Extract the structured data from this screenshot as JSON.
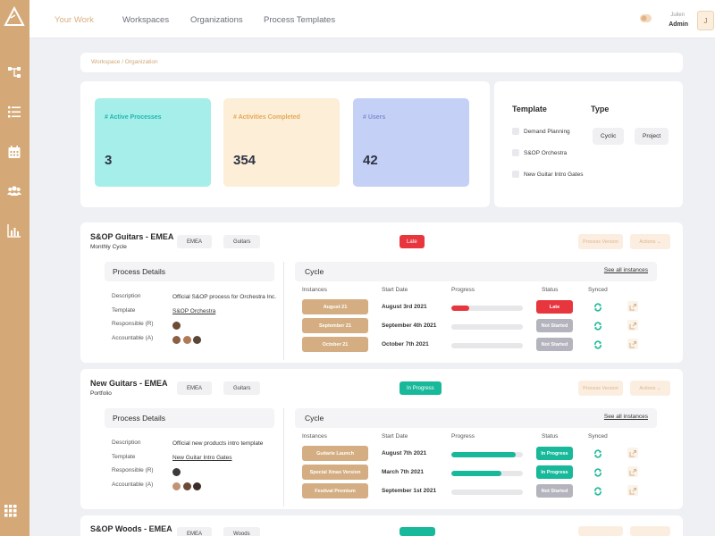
{
  "colors": {
    "accent": "#d5a977",
    "teal": "#18b99a",
    "red": "#e8363f",
    "grey": "#b4b4be"
  },
  "rail": {
    "icons": [
      "logo-triangle-icon",
      "hierarchy-icon",
      "list-icon",
      "calendar-icon",
      "users-icon",
      "bar-chart-icon",
      "apps-grid-icon"
    ]
  },
  "nav": {
    "items": [
      "Your Work",
      "Workspaces",
      "Organizations",
      "Process Templates"
    ],
    "active": "Your Work"
  },
  "user": {
    "name": "Julien",
    "role": "Admin",
    "avatar_initial": "J"
  },
  "breadcrumb": "Workspace / Organization",
  "stats": [
    {
      "label": "# Active Processes",
      "value": "3"
    },
    {
      "label": "# Activities Completed",
      "value": "354"
    },
    {
      "label": "# Users",
      "value": "42"
    }
  ],
  "filters": {
    "template_heading": "Template",
    "templates": [
      "Demand Planning",
      "S&OP Orchestra",
      "New Guitar Intro Gates"
    ],
    "type_heading": "Type",
    "types": [
      "Cyclic",
      "Project"
    ]
  },
  "processes": [
    {
      "title": "S&OP Guitars - EMEA",
      "subtitle": "Monthly Cycle",
      "tags": [
        "EMEA",
        "Guitars"
      ],
      "state": "Late",
      "state_color": "#e8363f",
      "process_version_label": "Process Version",
      "actions_label": "Actions",
      "details_title": "Process Details",
      "details": {
        "description_label": "Description",
        "description": "Official S&OP process for Orchestra Inc.",
        "template_label": "Template",
        "template": "S&OP Orchestra",
        "responsible_label": "Responsible (R)",
        "accountable_label": "Accountable (A)"
      },
      "cycle_title": "Cycle",
      "see_all": "See all instances",
      "columns": [
        "Instances",
        "Start Date",
        "Progress",
        "Status",
        "Synced"
      ],
      "instances": [
        {
          "name": "August 21",
          "start": "August 3rd 2021",
          "progress": 0.25,
          "progress_color": "#e8363f",
          "status": "Late",
          "status_color": "#e8363f"
        },
        {
          "name": "September 21",
          "start": "September 4th 2021",
          "progress": 0,
          "progress_color": "#e8363f",
          "status": "Not Started",
          "status_color": "#b4b4be"
        },
        {
          "name": "October 21",
          "start": "October 7th 2021",
          "progress": 0,
          "progress_color": "#e8363f",
          "status": "Not Started",
          "status_color": "#b4b4be"
        }
      ]
    },
    {
      "title": "New Guitars - EMEA",
      "subtitle": "Portfolio",
      "tags": [
        "EMEA",
        "Guitars"
      ],
      "state": "In Progress",
      "state_color": "#18b99a",
      "process_version_label": "Process Version",
      "actions_label": "Actions",
      "details_title": "Process Details",
      "details": {
        "description_label": "Description",
        "description": "Official new products intro template",
        "template_label": "Template",
        "template": "New Guitar Intro Gates",
        "responsible_label": "Responsible (R)",
        "accountable_label": "Accountable (A)"
      },
      "cycle_title": "Cycle",
      "see_all": "See all instances",
      "columns": [
        "Instances",
        "Start Date",
        "Progress",
        "Status",
        "Synced"
      ],
      "instances": [
        {
          "name": "Guitarie Launch",
          "start": "August 7th 2021",
          "progress": 0.9,
          "progress_color": "#18b99a",
          "status": "In Progress",
          "status_color": "#18b99a"
        },
        {
          "name": "Special Xmas Version",
          "start": "March 7th 2021",
          "progress": 0.7,
          "progress_color": "#18b99a",
          "status": "In Progress",
          "status_color": "#18b99a"
        },
        {
          "name": "Festival Premium",
          "start": "September 1st 2021",
          "progress": 0,
          "progress_color": "#18b99a",
          "status": "Not Started",
          "status_color": "#b4b4be"
        }
      ]
    },
    {
      "title": "S&OP Woods - EMEA",
      "tags": [
        "EMEA",
        "Woods"
      ],
      "state_color": "#18b99a"
    }
  ]
}
